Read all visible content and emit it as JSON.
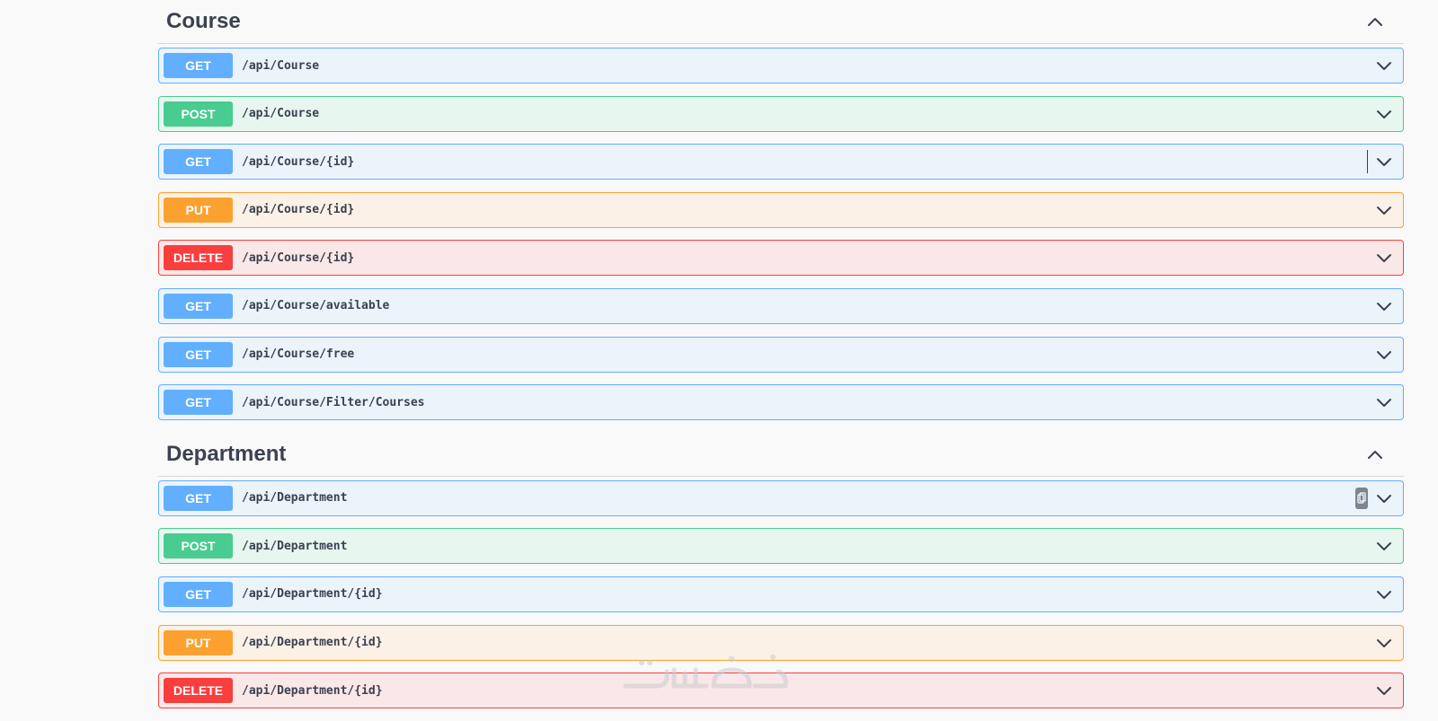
{
  "sections": [
    {
      "title": "Course",
      "operations": [
        {
          "method": "GET",
          "path": "/api/Course"
        },
        {
          "method": "POST",
          "path": "/api/Course"
        },
        {
          "method": "GET",
          "path": "/api/Course/{id}"
        },
        {
          "method": "PUT",
          "path": "/api/Course/{id}"
        },
        {
          "method": "DELETE",
          "path": "/api/Course/{id}"
        },
        {
          "method": "GET",
          "path": "/api/Course/available"
        },
        {
          "method": "GET",
          "path": "/api/Course/free"
        },
        {
          "method": "GET",
          "path": "/api/Course/Filter/Courses"
        }
      ]
    },
    {
      "title": "Department",
      "operations": [
        {
          "method": "GET",
          "path": "/api/Department"
        },
        {
          "method": "POST",
          "path": "/api/Department"
        },
        {
          "method": "GET",
          "path": "/api/Department/{id}"
        },
        {
          "method": "PUT",
          "path": "/api/Department/{id}"
        },
        {
          "method": "DELETE",
          "path": "/api/Department/{id}"
        }
      ]
    }
  ],
  "icons": {
    "section_toggle": "chevron-up-icon",
    "op_toggle": "chevron-down-icon",
    "copy": "copy-icon"
  },
  "colors": {
    "get": "#61affe",
    "post": "#49cc90",
    "put": "#fca130",
    "delete": "#f93e3e",
    "text": "#3b4151"
  }
}
